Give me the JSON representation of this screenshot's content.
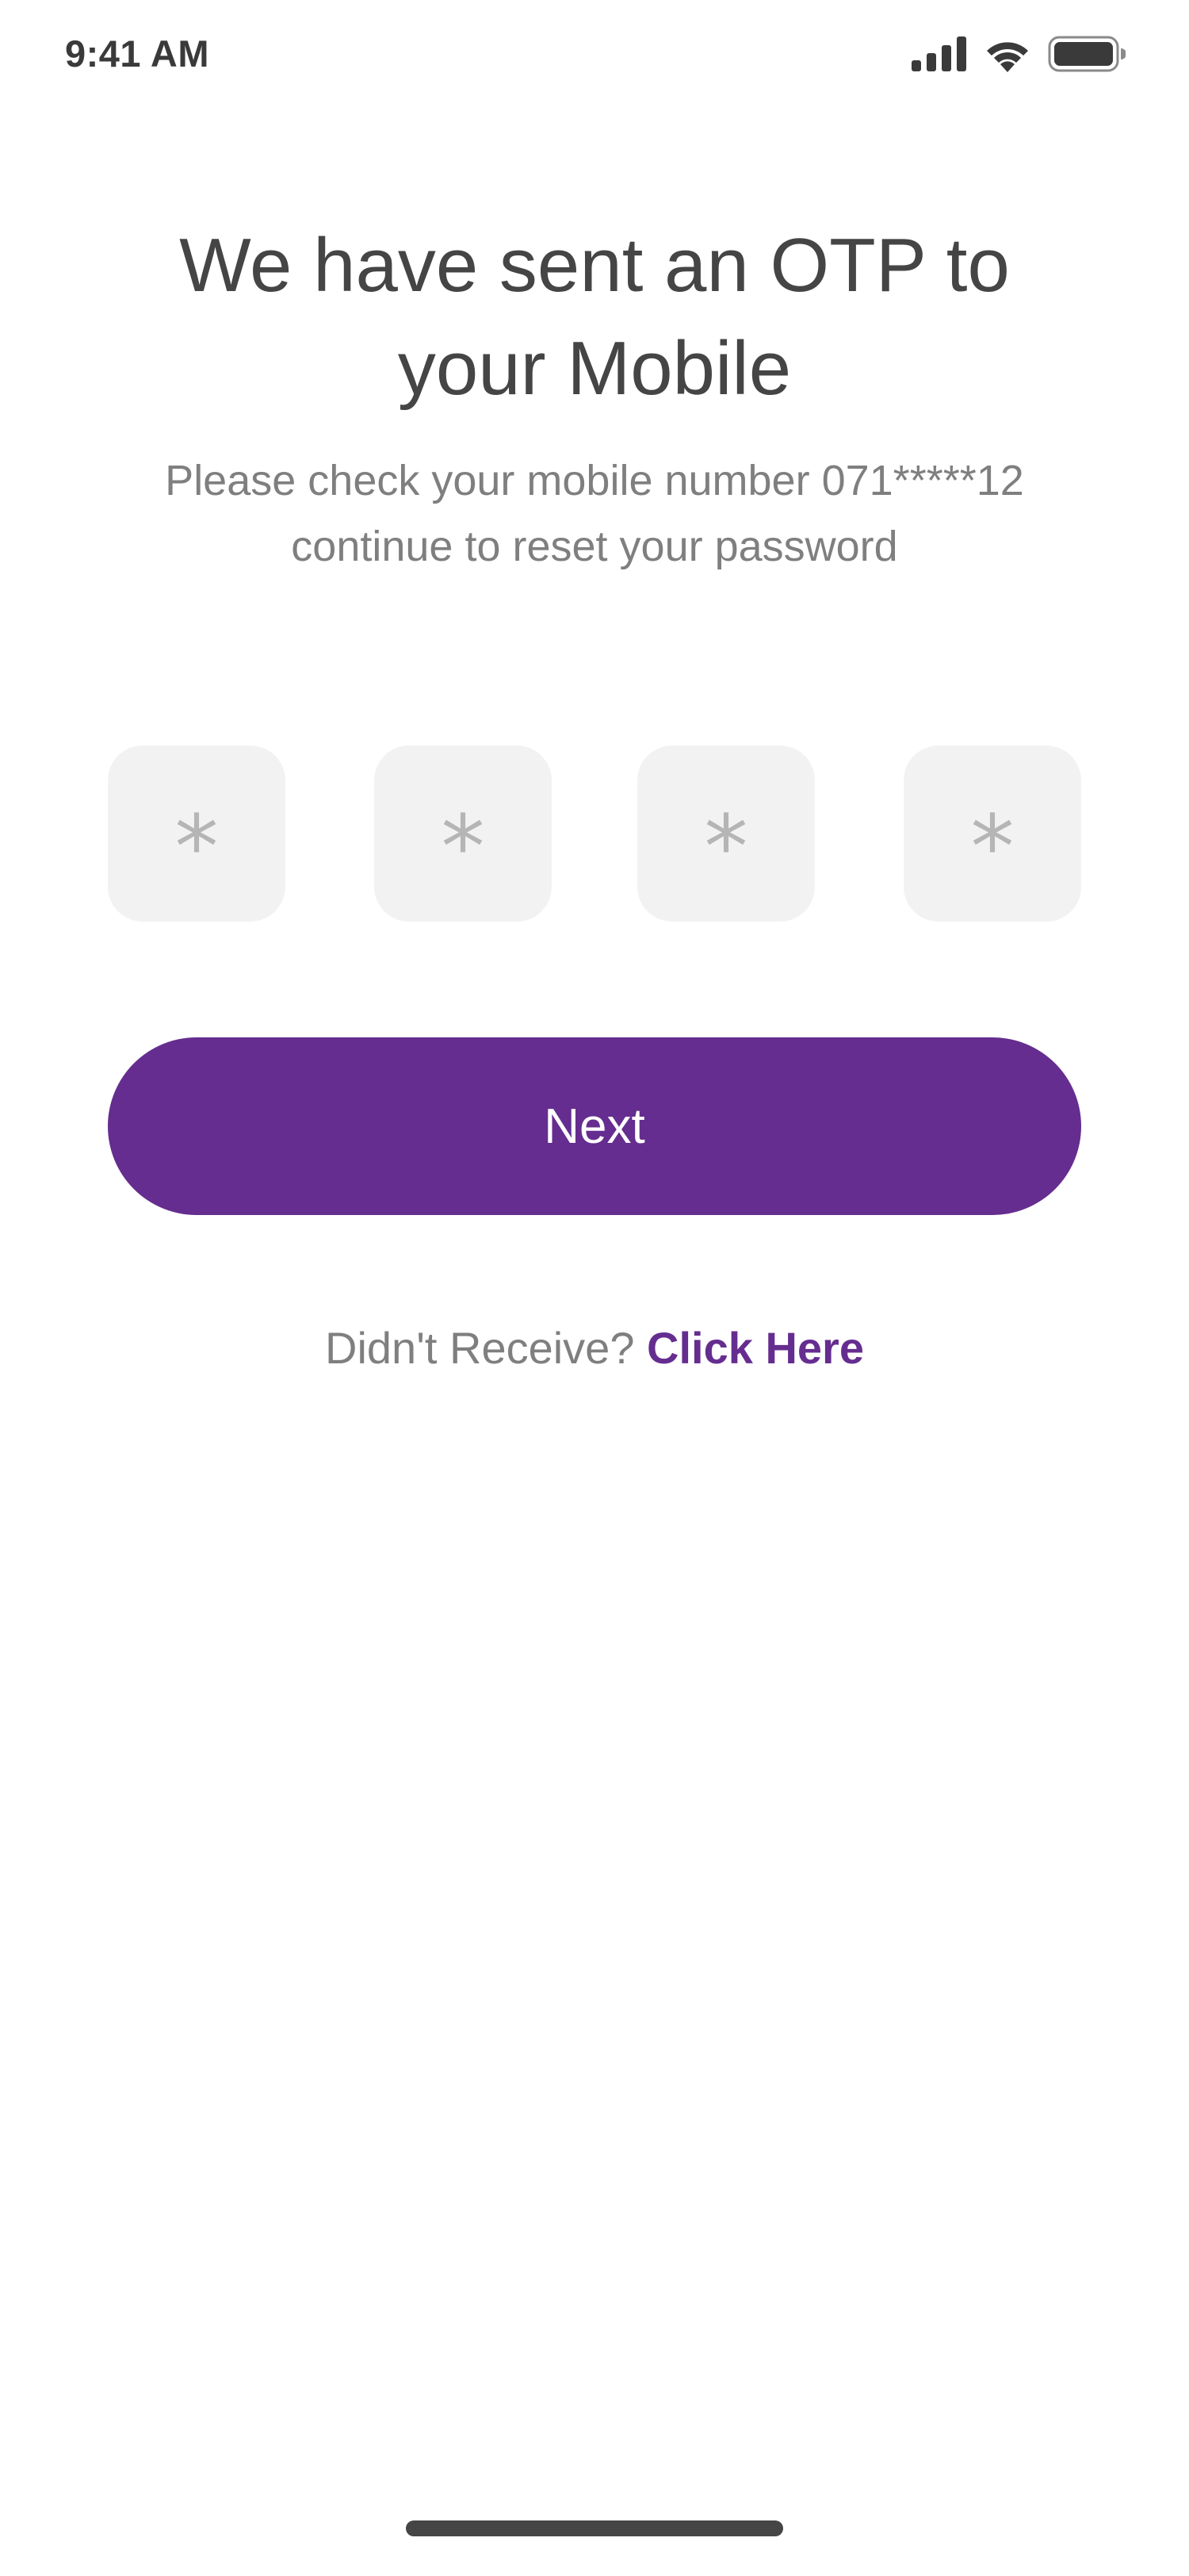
{
  "status_bar": {
    "time": "9:41 AM",
    "icons": [
      "cellular-signal-icon",
      "wifi-icon",
      "battery-icon"
    ]
  },
  "header": {
    "title_line1": "We have sent an OTP to",
    "title_line2": "your Mobile",
    "subtitle_line1": "Please check your mobile number 071*****12",
    "subtitle_line2": "continue to reset your password"
  },
  "otp": {
    "digits": [
      {
        "placeholder": "*",
        "value": ""
      },
      {
        "placeholder": "*",
        "value": ""
      },
      {
        "placeholder": "*",
        "value": ""
      },
      {
        "placeholder": "*",
        "value": ""
      }
    ]
  },
  "actions": {
    "next_label": "Next",
    "resend_prefix": "Didn't Receive?",
    "resend_link": "Click Here"
  },
  "colors": {
    "accent": "#652d8f",
    "title_text": "#454545",
    "muted_text": "#7f7f7f",
    "otp_box_bg": "#f2f2f2",
    "otp_placeholder": "#b5b5b5",
    "background": "#ffffff"
  }
}
